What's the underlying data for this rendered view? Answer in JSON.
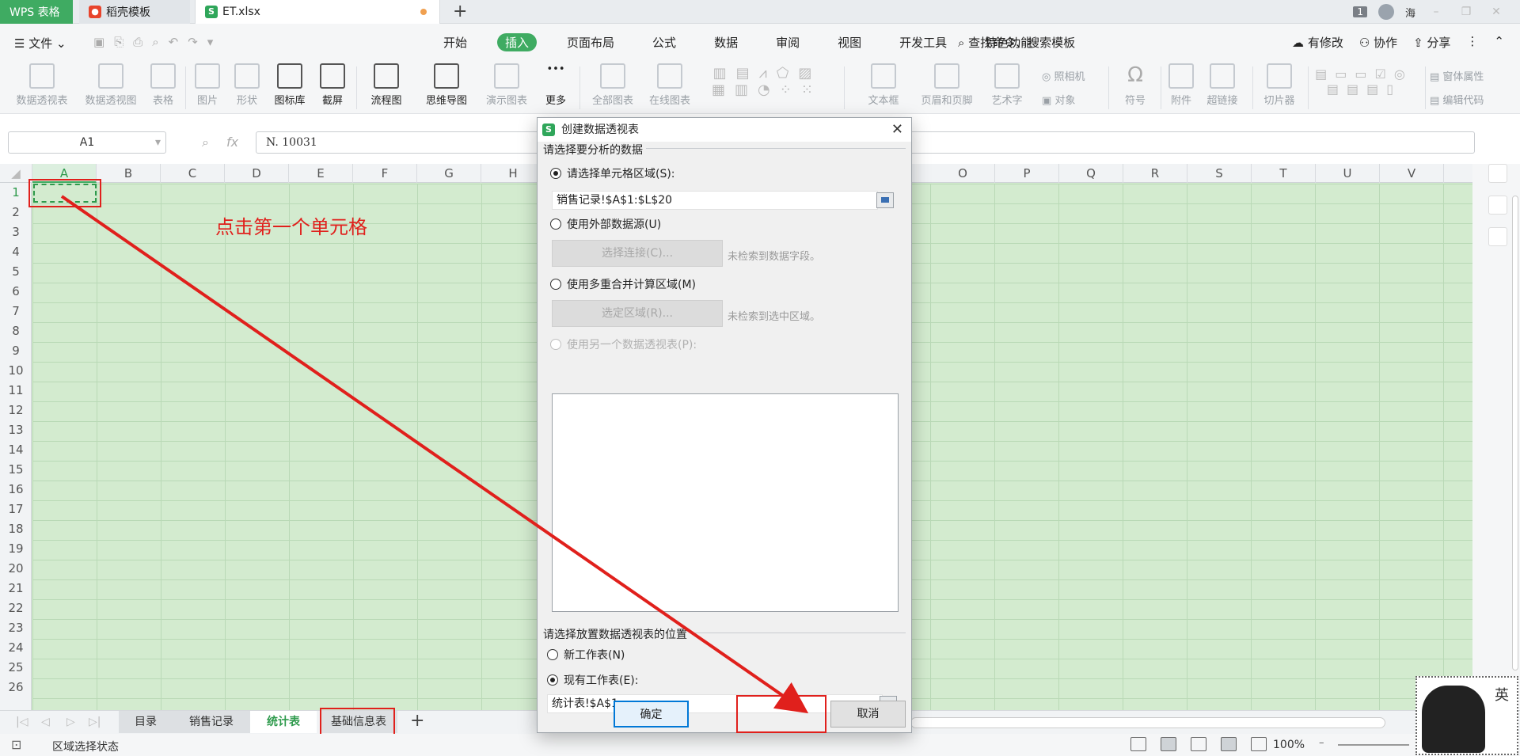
{
  "tabs": {
    "wps": "WPS 表格",
    "daoke": "稻壳模板",
    "file": "ET.xlsx",
    "add": "+"
  },
  "window": {
    "count": "1",
    "user": "海"
  },
  "menu": {
    "file": "文件",
    "tabs": [
      "开始",
      "插入",
      "页面布局",
      "公式",
      "数据",
      "审阅",
      "视图",
      "开发工具",
      "特色功能"
    ],
    "search": "查找命令、搜索模板",
    "right": [
      "有修改",
      "协作",
      "分享"
    ]
  },
  "ribbon": {
    "pivot_table": "数据透视表",
    "pivot_chart": "数据透视图",
    "table": "表格",
    "picture": "图片",
    "shape": "形状",
    "icons": "图标库",
    "screenshot": "截屏",
    "flowchart": "流程图",
    "mindmap": "思维导图",
    "demo_chart": "演示图表",
    "more": "更多",
    "all_charts": "全部图表",
    "online_charts": "在线图表",
    "textbox": "文本框",
    "header_footer": "页眉和页脚",
    "wordart": "艺术字",
    "camera": "照相机",
    "object": "对象",
    "symbol": "符号",
    "attachment": "附件",
    "hyperlink": "超链接",
    "slicer": "切片器",
    "window_props": "窗体属性",
    "edit_code": "编辑代码"
  },
  "formula_bar": {
    "cell_ref": "A1",
    "fx": "fx",
    "value": "N. 10031"
  },
  "columns": [
    "A",
    "B",
    "C",
    "D",
    "E",
    "F",
    "G",
    "H",
    "O",
    "P",
    "Q",
    "R",
    "S",
    "T",
    "U",
    "V"
  ],
  "rows": [
    "1",
    "2",
    "3",
    "4",
    "5",
    "6",
    "7",
    "8",
    "9",
    "10",
    "11",
    "12",
    "13",
    "14",
    "15",
    "16",
    "17",
    "18",
    "19",
    "20",
    "21",
    "22",
    "23",
    "24",
    "25",
    "26"
  ],
  "annotation": "点击第一个单元格",
  "dialog": {
    "title": "创建数据透视表",
    "section_source": "请选择要分析的数据",
    "opt_range": "请选择单元格区域(S):",
    "range_value": "销售记录!$A$1:$L$20",
    "opt_external": "使用外部数据源(U)",
    "btn_connect": "选择连接(C)...",
    "hint_connect": "未检索到数据字段。",
    "opt_multi": "使用多重合并计算区域(M)",
    "btn_region": "选定区域(R)...",
    "hint_region": "未检索到选中区域。",
    "opt_other_pivot": "使用另一个数据透视表(P):",
    "section_location": "请选择放置数据透视表的位置",
    "opt_new_sheet": "新工作表(N)",
    "opt_existing": "现有工作表(E):",
    "existing_value": "统计表!$A$1",
    "ok": "确定",
    "cancel": "取消"
  },
  "sheets": [
    "目录",
    "销售记录",
    "统计表",
    "基础信息表"
  ],
  "active_sheet": "统计表",
  "status": {
    "text": "区域选择状态",
    "zoom": "100%"
  },
  "ime": {
    "lang": "英"
  },
  "colors": {
    "accent": "#3fab62",
    "annotation_red": "#e0201c",
    "grid_bg": "#d3ebcf"
  }
}
